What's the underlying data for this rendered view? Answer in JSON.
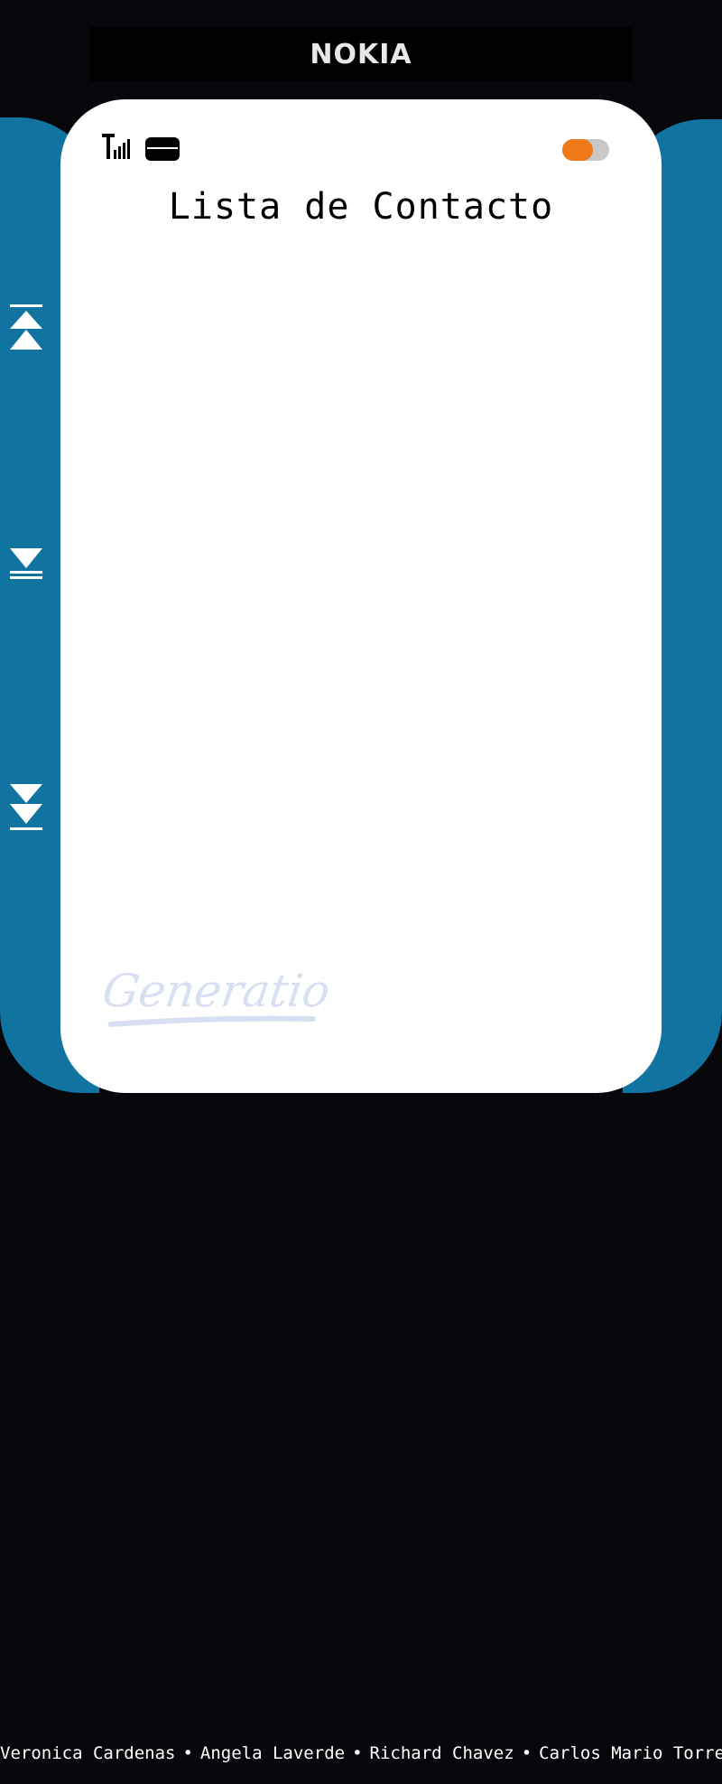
{
  "header": {
    "logo_text": "NOKIA"
  },
  "screen": {
    "title": "Lista de Contacto",
    "brand_mark_text": "Generation",
    "toggle_on": true
  },
  "side_nav": [
    {
      "name": "go-first-icon"
    },
    {
      "name": "go-next-icon"
    },
    {
      "name": "go-last-icon"
    }
  ],
  "footer": {
    "names": [
      "Veronica Cardenas",
      "Angela Laverde",
      "Richard Chavez",
      "Carlos Mario Torres"
    ],
    "separator": "•"
  },
  "colors": {
    "background": "#06070a",
    "shell": "#11739f",
    "screen": "#ffffff",
    "toggle_knob": "#f07a1a",
    "toggle_track": "#c8c8c8",
    "brand_mark": "#d8dff2"
  }
}
